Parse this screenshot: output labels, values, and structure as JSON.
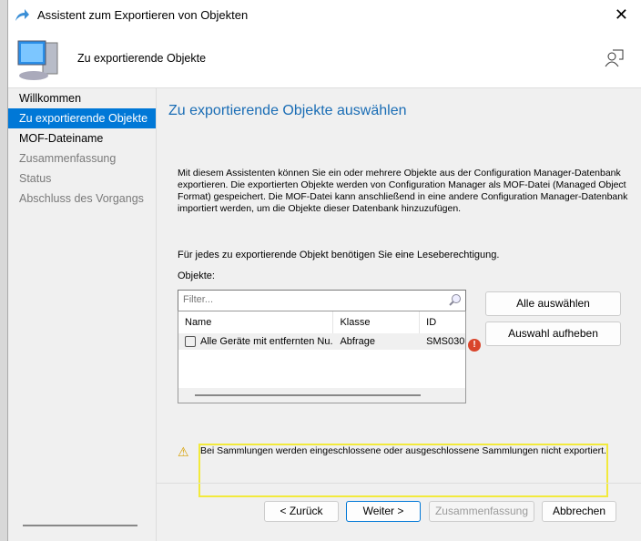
{
  "window": {
    "title": "Assistent zum Exportieren von Objekten",
    "close": "✕"
  },
  "header": {
    "title": "Zu exportierende Objekte"
  },
  "nav": [
    {
      "label": "Willkommen"
    },
    {
      "label": "Zu exportierende Objekte"
    },
    {
      "label": "MOF-Dateiname"
    },
    {
      "label": "Zusammenfassung"
    },
    {
      "label": "Status"
    },
    {
      "label": "Abschluss des Vorgangs"
    }
  ],
  "main": {
    "heading": "Zu exportierende Objekte auswählen",
    "description": "Mit diesem Assistenten können Sie ein oder mehrere Objekte aus der Configuration Manager-Datenbank exportieren. Die exportierten Objekte werden von Configuration Manager als MOF-Datei (Managed Object Format) gespeichert. Die MOF-Datei kann anschließend in eine andere Configuration Manager-Datenbank importiert werden, um die Objekte dieser Datenbank hinzuzufügen.",
    "permission_note": "Für jedes zu exportierende Objekt benötigen Sie eine Leseberechtigung.",
    "objects_label": "Objekte:",
    "filter_placeholder": "Filter...",
    "columns": [
      "Name",
      "Klasse",
      "ID"
    ],
    "rows": [
      {
        "name": "Alle Geräte mit entfernten Nu...",
        "class": "Abfrage",
        "id": "SMS030"
      }
    ],
    "select_all": "Alle auswählen",
    "deselect": "Auswahl aufheben",
    "warning": "Bei Sammlungen werden eingeschlossene oder ausgeschlossene Sammlungen nicht exportiert."
  },
  "footer": {
    "back": "< Zurück",
    "next": "Weiter >",
    "summary": "Zusammenfassung",
    "cancel": "Abbrechen"
  }
}
